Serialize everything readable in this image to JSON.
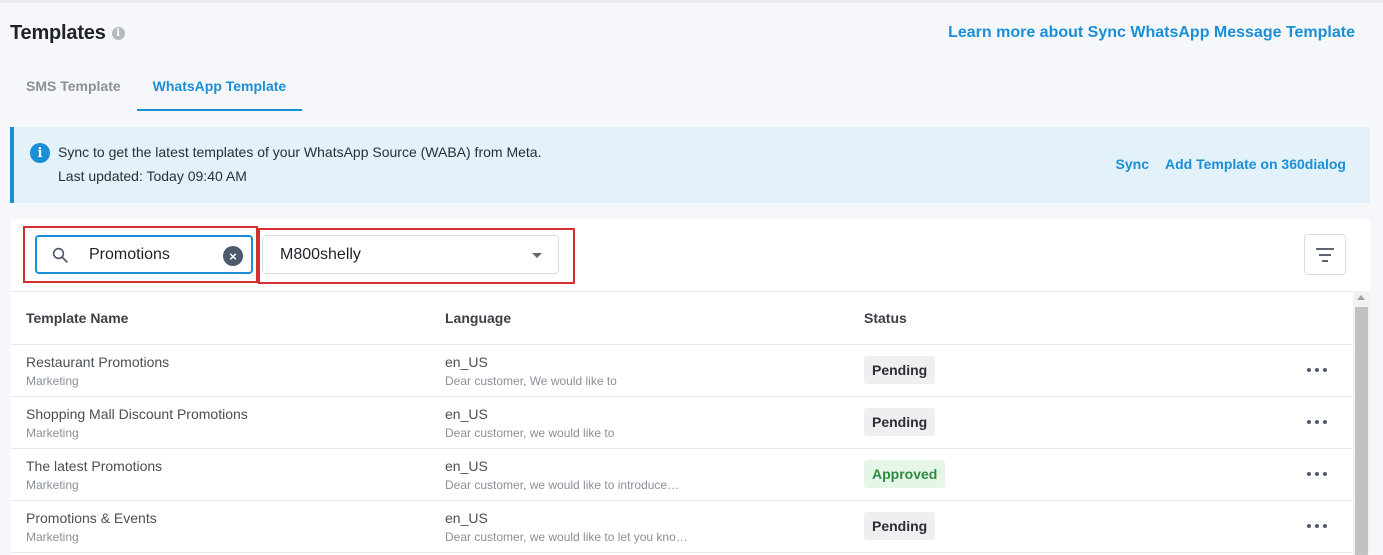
{
  "header": {
    "title": "Templates",
    "info_icon": "i",
    "learn_link": "Learn more about Sync WhatsApp Message Template"
  },
  "tabs": [
    {
      "label": "SMS Template",
      "active": false
    },
    {
      "label": "WhatsApp Template",
      "active": true
    }
  ],
  "banner": {
    "icon": "i",
    "line1": "Sync to get the latest templates of your WhatsApp Source (WABA) from Meta.",
    "line2": "Last updated: Today 09:40 AM",
    "sync_label": "Sync",
    "add_label": "Add Template on 360dialog"
  },
  "filters": {
    "search_value": "Promotions",
    "clear_icon": "×",
    "source_selected": "M800shelly"
  },
  "table": {
    "columns": [
      "Template Name",
      "Language",
      "Status"
    ],
    "rows": [
      {
        "name": "Restaurant Promotions",
        "category": "Marketing",
        "language": "en_US",
        "preview": "Dear customer, We would like to",
        "status": "Pending"
      },
      {
        "name": "Shopping Mall Discount Promotions",
        "category": "Marketing",
        "language": "en_US",
        "preview": "Dear customer, we would like to",
        "status": "Pending"
      },
      {
        "name": "The latest Promotions",
        "category": "Marketing",
        "language": "en_US",
        "preview": "Dear customer, we would like to introduce…",
        "status": "Approved"
      },
      {
        "name": "Promotions & Events",
        "category": "Marketing",
        "language": "en_US",
        "preview": "Dear customer, we would like to let you kno…",
        "status": "Pending"
      }
    ]
  },
  "colors": {
    "accent": "#1a8fd6",
    "highlight": "#d32f2f",
    "pending_bg": "#eeeff1",
    "approved_bg": "#e5f6e8",
    "approved_text": "#2e8b3e"
  }
}
